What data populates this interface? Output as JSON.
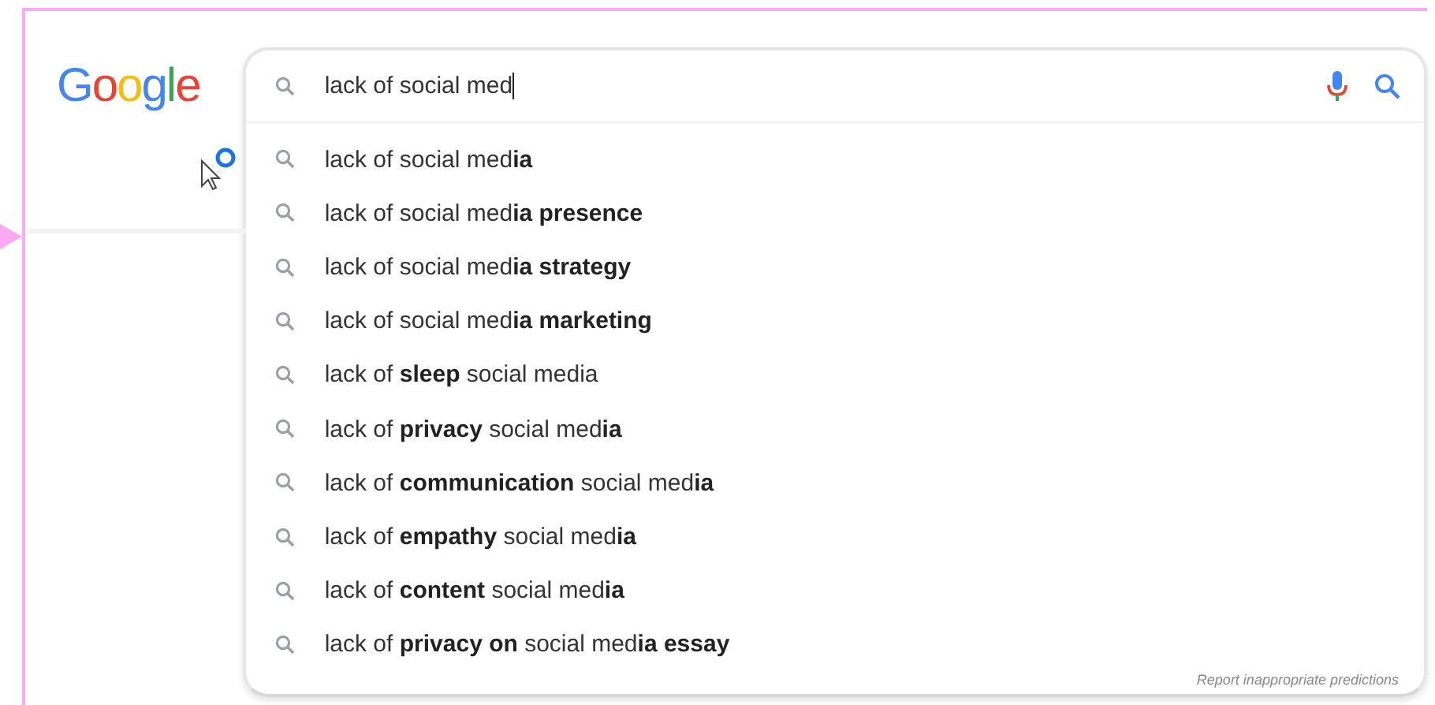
{
  "logo": "Google",
  "search": {
    "value": "lack of social med"
  },
  "suggestions": [
    {
      "text": "lack of social med**ia**"
    },
    {
      "text": "lack of social med**ia presence**"
    },
    {
      "text": "lack of social med**ia strategy**"
    },
    {
      "text": "lack of social med**ia marketing**"
    },
    {
      "text": "lack of **sleep** social media"
    },
    {
      "text": "lack of **privacy** social med**ia**"
    },
    {
      "text": "lack of **communication** social med**ia**"
    },
    {
      "text": "lack of **empathy** social med**ia**"
    },
    {
      "text": "lack of **content** social med**ia**"
    },
    {
      "text": "lack of **privacy on** social med**ia essay**"
    }
  ],
  "report_link": "Report inappropriate predictions"
}
